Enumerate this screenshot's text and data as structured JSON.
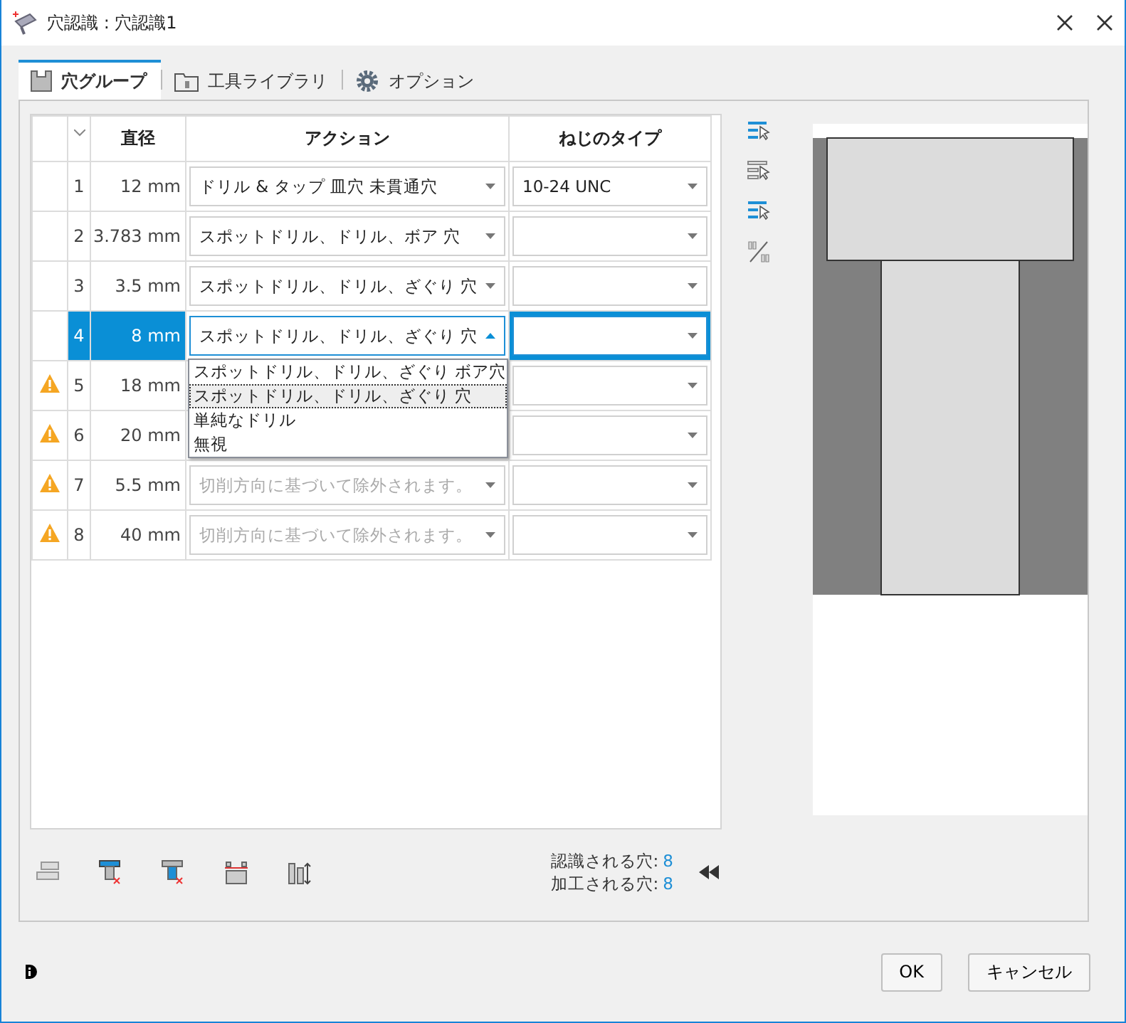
{
  "window": {
    "title": "穴認識 : 穴認識1"
  },
  "tabs": [
    {
      "label": "穴グループ",
      "selected": true
    },
    {
      "label": "工具ライブラリ",
      "selected": false
    },
    {
      "label": "オプション",
      "selected": false
    }
  ],
  "table": {
    "columns": [
      "直径",
      "アクション",
      "ねじのタイプ"
    ],
    "rows": [
      {
        "number": "1",
        "diameter": "12 mm",
        "action": "ドリル & タップ 皿穴 未貫通穴",
        "thread": "10-24 UNC",
        "warning": false,
        "selected": false,
        "disabled": false,
        "open": false
      },
      {
        "number": "2",
        "diameter": "3.783 mm",
        "action": "スポットドリル、ドリル、ボア 穴",
        "warning": false,
        "selected": false,
        "disabled": false,
        "open": false
      },
      {
        "number": "3",
        "diameter": "3.5 mm",
        "action": "スポットドリル、ドリル、ざぐり 穴",
        "warning": false,
        "selected": false,
        "disabled": false,
        "open": false
      },
      {
        "number": "4",
        "diameter": "8 mm",
        "action": "スポットドリル、ドリル、ざぐり 穴",
        "warning": false,
        "selected": true,
        "disabled": false,
        "open": true
      },
      {
        "number": "5",
        "diameter": "18 mm",
        "warning": true,
        "selected": false,
        "disabled": false,
        "open": false
      },
      {
        "number": "6",
        "diameter": "20 mm",
        "warning": true,
        "selected": false,
        "disabled": false,
        "open": false
      },
      {
        "number": "7",
        "diameter": "5.5 mm",
        "action": "切削方向に基づいて除外されます。",
        "warning": true,
        "selected": false,
        "disabled": true,
        "open": false
      },
      {
        "number": "8",
        "diameter": "40 mm",
        "action": "切削方向に基づいて除外されます。",
        "warning": true,
        "selected": false,
        "disabled": true,
        "open": false
      }
    ]
  },
  "dropdown": {
    "options": [
      {
        "label": "スポットドリル、ドリル、ざぐり ボア穴",
        "selected": false
      },
      {
        "label": "スポットドリル、ドリル、ざぐり 穴",
        "selected": true
      },
      {
        "label": "単純なドリル",
        "selected": false
      },
      {
        "label": "無視",
        "selected": false
      }
    ]
  },
  "summary": [
    {
      "label": "認識される穴:",
      "value": "8"
    },
    {
      "label": "加工される穴:",
      "value": "8"
    }
  ],
  "buttons": [
    "OK",
    "キャンセル"
  ]
}
